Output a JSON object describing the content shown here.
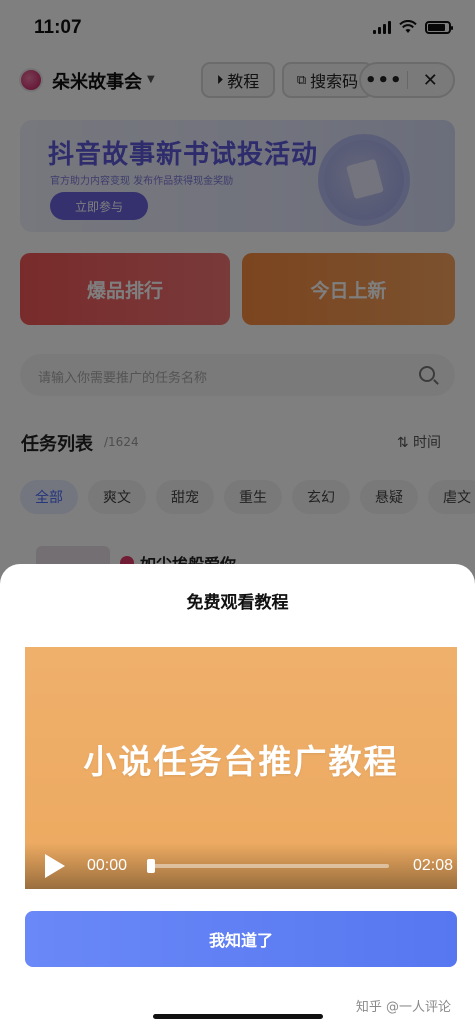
{
  "status_bar": {
    "time": "11:07",
    "battery_level": 0.85
  },
  "nav": {
    "app_name": "朵米故事会",
    "tutorial_label": "教程",
    "search_code_label": "搜索码",
    "more_label": "•••",
    "close_label": "✕"
  },
  "banner": {
    "title": "抖音故事新书试投活动",
    "subtitle": "官方助力内容变现 发布作品获得现金奖励",
    "button": "立即参与"
  },
  "cards": {
    "ranking": "爆品排行",
    "today_new": "今日上新"
  },
  "search": {
    "placeholder": "请输入你需要推广的任务名称"
  },
  "task_list": {
    "title": "任务列表",
    "count": "/1624",
    "sort_label": "⇅ 时间",
    "categories": [
      "全部",
      "爽文",
      "甜宠",
      "重生",
      "玄幻",
      "悬疑",
      "虐文"
    ],
    "first_task_title": "如尘埃般爱你"
  },
  "modal": {
    "title": "免费观看教程",
    "video": {
      "caption": "小说任务台推广教程",
      "current_time": "00:00",
      "total_time": "02:08",
      "progress": 0.0
    },
    "confirm_button": "我知道了"
  },
  "watermark": "知乎 @一人评论",
  "colors": {
    "accent": "#5677f0",
    "video_bg": "#eca95f",
    "banner_purple": "#5d58d8",
    "card_red": "#f25757",
    "card_orange": "#f68a3f"
  }
}
